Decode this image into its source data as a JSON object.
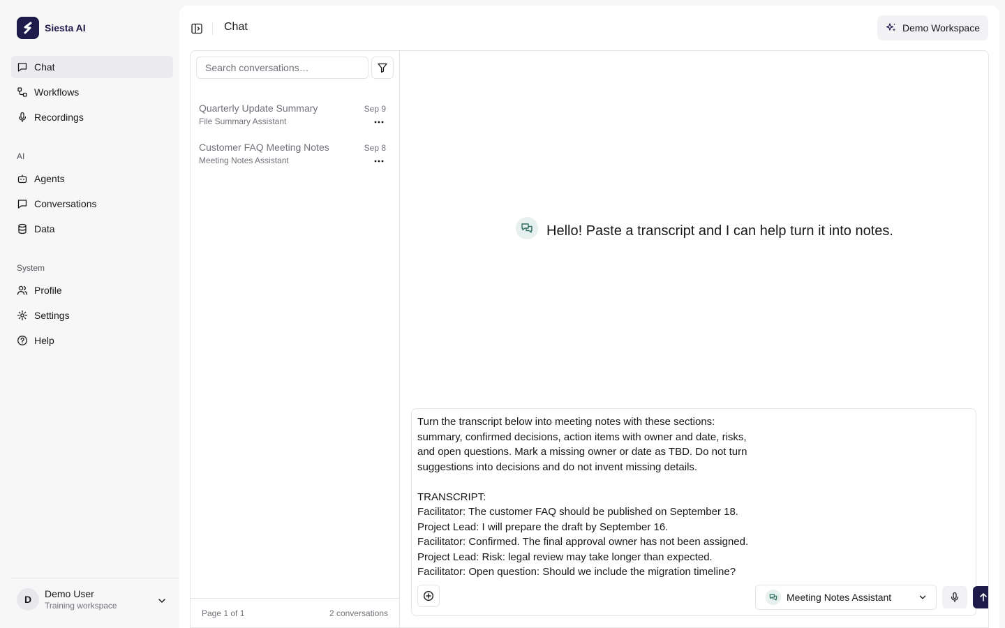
{
  "brand": {
    "name": "Siesta AI"
  },
  "sidebar": {
    "primary": [
      {
        "label": "Chat",
        "icon": "chat-icon",
        "active": true
      },
      {
        "label": "Workflows",
        "icon": "workflow-icon"
      },
      {
        "label": "Recordings",
        "icon": "mic-icon"
      }
    ],
    "ai_heading": "AI",
    "ai": [
      {
        "label": "Agents",
        "icon": "bot-icon"
      },
      {
        "label": "Conversations",
        "icon": "chat-icon"
      },
      {
        "label": "Data",
        "icon": "database-icon"
      }
    ],
    "system_heading": "System",
    "system": [
      {
        "label": "Profile",
        "icon": "users-icon"
      },
      {
        "label": "Settings",
        "icon": "gear-icon"
      },
      {
        "label": "Help",
        "icon": "help-icon"
      }
    ],
    "user": {
      "initial": "D",
      "name": "Demo User",
      "workspace": "Training workspace"
    }
  },
  "header": {
    "title": "Chat",
    "workspace_button": "Demo Workspace"
  },
  "conversations": {
    "search_placeholder": "Search conversations…",
    "items": [
      {
        "title": "Quarterly Update Summary",
        "agent": "File Summary Assistant",
        "date": "Sep 9"
      },
      {
        "title": "Customer FAQ Meeting Notes",
        "agent": "Meeting Notes Assistant",
        "date": "Sep 8"
      }
    ],
    "footer": {
      "page": "Page 1 of 1",
      "count": "2 conversations"
    }
  },
  "chat": {
    "greeting": "Hello! Paste a transcript and I can help turn it into notes.",
    "composer_text": "Turn the transcript below into meeting notes with these sections: summary, confirmed decisions, action items with owner and date, risks, and open questions. Mark a missing owner or date as TBD. Do not turn suggestions into decisions and do not invent missing details.\n\nTRANSCRIPT:\nFacilitator: The customer FAQ should be published on September 18.\nProject Lead: I will prepare the draft by September 16.\nFacilitator: Confirmed. The final approval owner has not been assigned.\nProject Lead: Risk: legal review may take longer than expected.\nFacilitator: Open question: Should we include the migration timeline?",
    "agent_select": "Meeting Notes Assistant"
  },
  "colors": {
    "accent": "#1e1b4b",
    "agent_badge": "#e6f0ee"
  }
}
